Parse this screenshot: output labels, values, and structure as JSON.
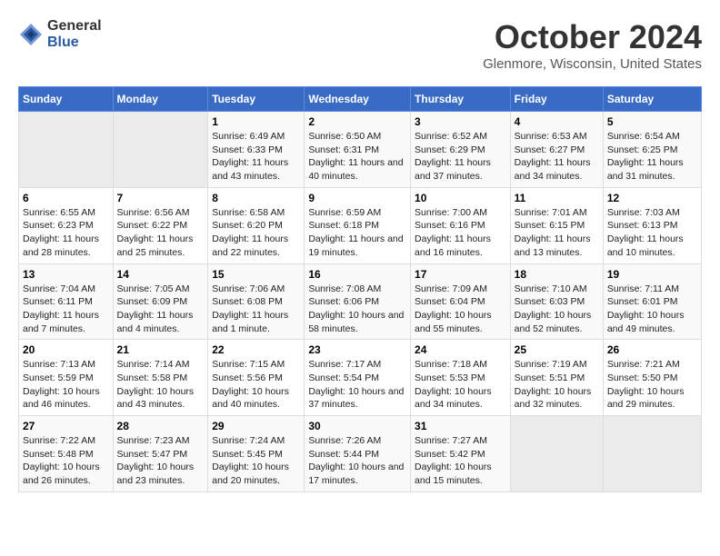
{
  "logo": {
    "general": "General",
    "blue": "Blue"
  },
  "header": {
    "month": "October 2024",
    "location": "Glenmore, Wisconsin, United States"
  },
  "weekdays": [
    "Sunday",
    "Monday",
    "Tuesday",
    "Wednesday",
    "Thursday",
    "Friday",
    "Saturday"
  ],
  "weeks": [
    [
      {
        "day": "",
        "empty": true
      },
      {
        "day": "",
        "empty": true
      },
      {
        "day": "1",
        "sunrise": "6:49 AM",
        "sunset": "6:33 PM",
        "daylight": "11 hours and 43 minutes."
      },
      {
        "day": "2",
        "sunrise": "6:50 AM",
        "sunset": "6:31 PM",
        "daylight": "11 hours and 40 minutes."
      },
      {
        "day": "3",
        "sunrise": "6:52 AM",
        "sunset": "6:29 PM",
        "daylight": "11 hours and 37 minutes."
      },
      {
        "day": "4",
        "sunrise": "6:53 AM",
        "sunset": "6:27 PM",
        "daylight": "11 hours and 34 minutes."
      },
      {
        "day": "5",
        "sunrise": "6:54 AM",
        "sunset": "6:25 PM",
        "daylight": "11 hours and 31 minutes."
      }
    ],
    [
      {
        "day": "6",
        "sunrise": "6:55 AM",
        "sunset": "6:23 PM",
        "daylight": "11 hours and 28 minutes."
      },
      {
        "day": "7",
        "sunrise": "6:56 AM",
        "sunset": "6:22 PM",
        "daylight": "11 hours and 25 minutes."
      },
      {
        "day": "8",
        "sunrise": "6:58 AM",
        "sunset": "6:20 PM",
        "daylight": "11 hours and 22 minutes."
      },
      {
        "day": "9",
        "sunrise": "6:59 AM",
        "sunset": "6:18 PM",
        "daylight": "11 hours and 19 minutes."
      },
      {
        "day": "10",
        "sunrise": "7:00 AM",
        "sunset": "6:16 PM",
        "daylight": "11 hours and 16 minutes."
      },
      {
        "day": "11",
        "sunrise": "7:01 AM",
        "sunset": "6:15 PM",
        "daylight": "11 hours and 13 minutes."
      },
      {
        "day": "12",
        "sunrise": "7:03 AM",
        "sunset": "6:13 PM",
        "daylight": "11 hours and 10 minutes."
      }
    ],
    [
      {
        "day": "13",
        "sunrise": "7:04 AM",
        "sunset": "6:11 PM",
        "daylight": "11 hours and 7 minutes."
      },
      {
        "day": "14",
        "sunrise": "7:05 AM",
        "sunset": "6:09 PM",
        "daylight": "11 hours and 4 minutes."
      },
      {
        "day": "15",
        "sunrise": "7:06 AM",
        "sunset": "6:08 PM",
        "daylight": "11 hours and 1 minute."
      },
      {
        "day": "16",
        "sunrise": "7:08 AM",
        "sunset": "6:06 PM",
        "daylight": "10 hours and 58 minutes."
      },
      {
        "day": "17",
        "sunrise": "7:09 AM",
        "sunset": "6:04 PM",
        "daylight": "10 hours and 55 minutes."
      },
      {
        "day": "18",
        "sunrise": "7:10 AM",
        "sunset": "6:03 PM",
        "daylight": "10 hours and 52 minutes."
      },
      {
        "day": "19",
        "sunrise": "7:11 AM",
        "sunset": "6:01 PM",
        "daylight": "10 hours and 49 minutes."
      }
    ],
    [
      {
        "day": "20",
        "sunrise": "7:13 AM",
        "sunset": "5:59 PM",
        "daylight": "10 hours and 46 minutes."
      },
      {
        "day": "21",
        "sunrise": "7:14 AM",
        "sunset": "5:58 PM",
        "daylight": "10 hours and 43 minutes."
      },
      {
        "day": "22",
        "sunrise": "7:15 AM",
        "sunset": "5:56 PM",
        "daylight": "10 hours and 40 minutes."
      },
      {
        "day": "23",
        "sunrise": "7:17 AM",
        "sunset": "5:54 PM",
        "daylight": "10 hours and 37 minutes."
      },
      {
        "day": "24",
        "sunrise": "7:18 AM",
        "sunset": "5:53 PM",
        "daylight": "10 hours and 34 minutes."
      },
      {
        "day": "25",
        "sunrise": "7:19 AM",
        "sunset": "5:51 PM",
        "daylight": "10 hours and 32 minutes."
      },
      {
        "day": "26",
        "sunrise": "7:21 AM",
        "sunset": "5:50 PM",
        "daylight": "10 hours and 29 minutes."
      }
    ],
    [
      {
        "day": "27",
        "sunrise": "7:22 AM",
        "sunset": "5:48 PM",
        "daylight": "10 hours and 26 minutes."
      },
      {
        "day": "28",
        "sunrise": "7:23 AM",
        "sunset": "5:47 PM",
        "daylight": "10 hours and 23 minutes."
      },
      {
        "day": "29",
        "sunrise": "7:24 AM",
        "sunset": "5:45 PM",
        "daylight": "10 hours and 20 minutes."
      },
      {
        "day": "30",
        "sunrise": "7:26 AM",
        "sunset": "5:44 PM",
        "daylight": "10 hours and 17 minutes."
      },
      {
        "day": "31",
        "sunrise": "7:27 AM",
        "sunset": "5:42 PM",
        "daylight": "10 hours and 15 minutes."
      },
      {
        "day": "",
        "empty": true
      },
      {
        "day": "",
        "empty": true
      }
    ]
  ],
  "labels": {
    "sunrise": "Sunrise:",
    "sunset": "Sunset:",
    "daylight": "Daylight:"
  }
}
